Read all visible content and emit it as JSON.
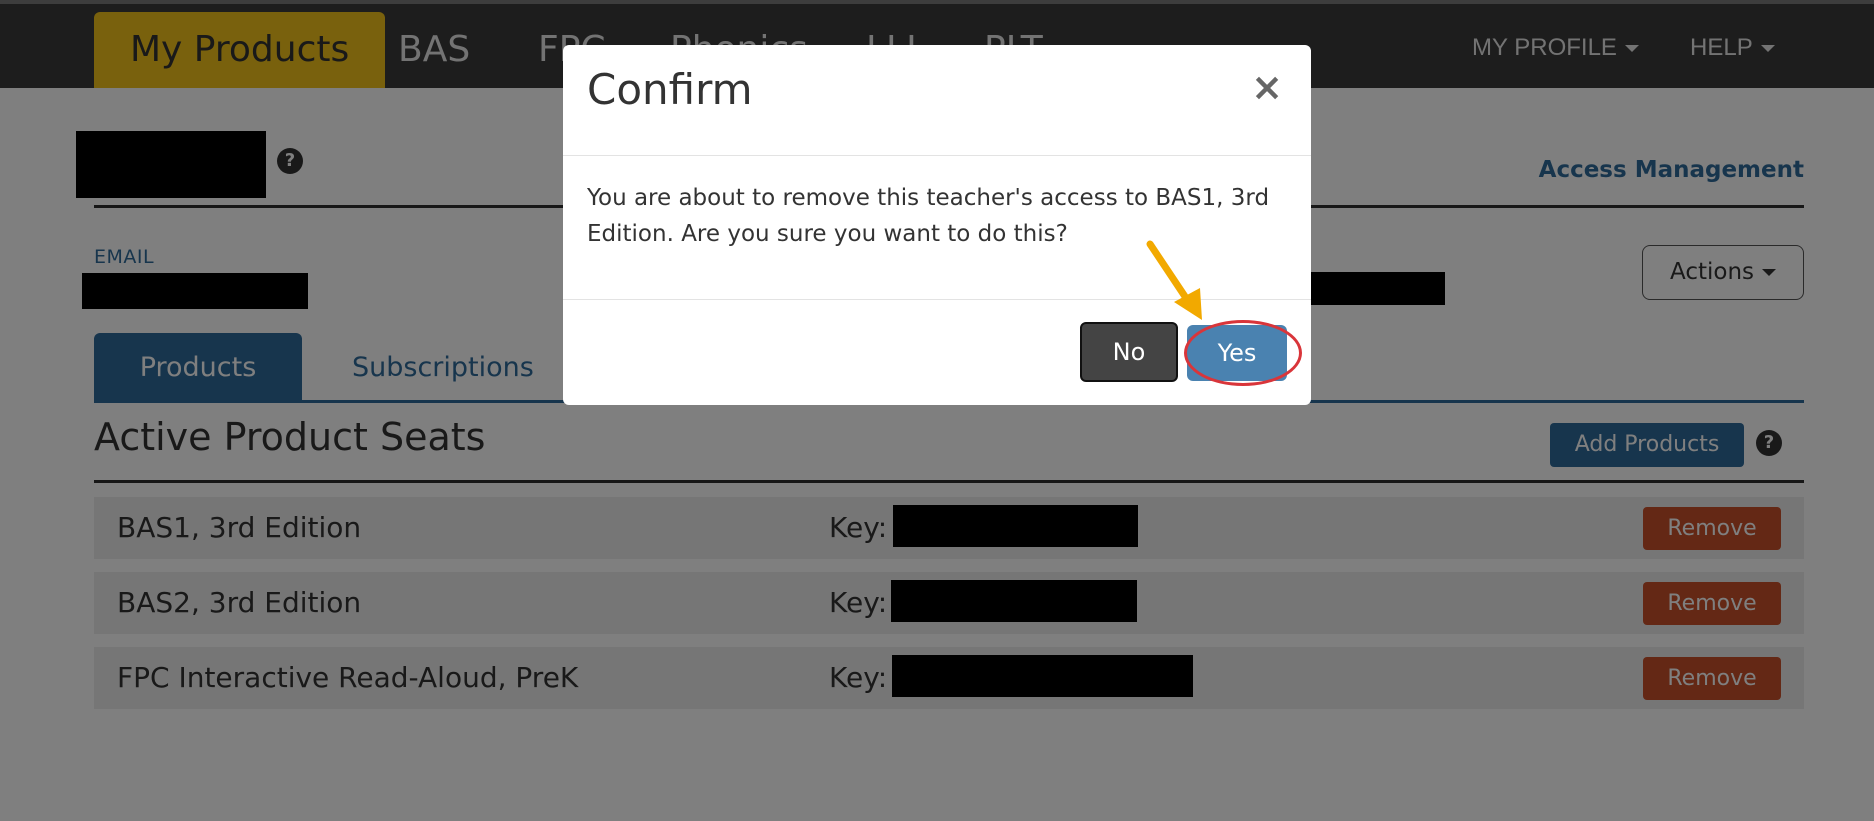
{
  "nav": {
    "items": [
      {
        "label": "My Products",
        "active": true
      },
      {
        "label": "BAS"
      },
      {
        "label": "FPC"
      },
      {
        "label": "Phonics"
      },
      {
        "label": "LLI"
      },
      {
        "label": "PLT"
      }
    ],
    "profile_label": "MY PROFILE",
    "help_label": "HELP"
  },
  "header": {
    "access_management": "Access Management",
    "help_glyph": "?"
  },
  "user": {
    "email_label": "EMAIL",
    "actions_label": "Actions"
  },
  "tabs": [
    {
      "label": "Products",
      "active": true
    },
    {
      "label": "Subscriptions"
    }
  ],
  "products": {
    "section_title": "Active Product Seats",
    "add_label": "Add Products",
    "help_glyph": "?",
    "key_label": "Key:",
    "remove_label": "Remove",
    "rows": [
      {
        "name": "BAS1, 3rd Edition"
      },
      {
        "name": "BAS2, 3rd Edition"
      },
      {
        "name": "FPC Interactive Read-Aloud, PreK"
      }
    ]
  },
  "modal": {
    "title": "Confirm",
    "close_glyph": "×",
    "message": "You are about to remove this teacher's access to BAS1, 3rd Edition. Are you sure you want to do this?",
    "no_label": "No",
    "yes_label": "Yes"
  },
  "colors": {
    "nav_bg": "#3a3a3a",
    "nav_active": "#f2c21a",
    "primary": "#2f6b9a",
    "danger": "#c8502a",
    "annotation_ring": "#d9353a",
    "annotation_arrow": "#f2a900"
  }
}
